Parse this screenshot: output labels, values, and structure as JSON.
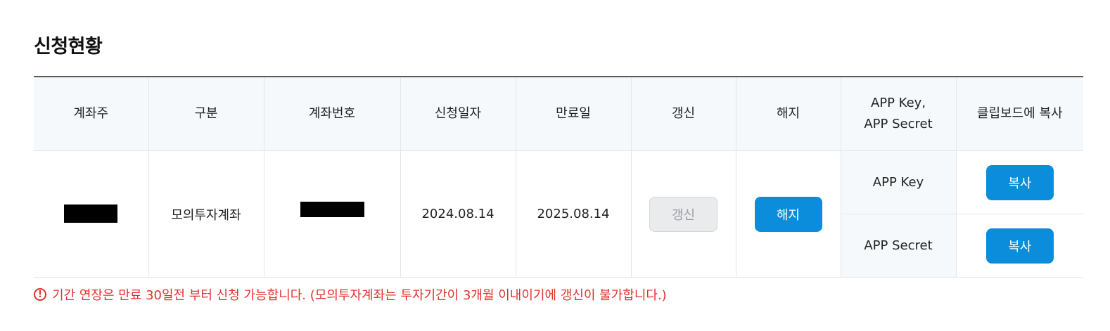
{
  "section": {
    "title": "신청현황"
  },
  "table": {
    "headers": {
      "holder": "계좌주",
      "type": "구분",
      "account_no": "계좌번호",
      "apply_date": "신청일자",
      "expiry_date": "만료일",
      "renew": "갱신",
      "cancel": "해지",
      "app_key_line1": "APP Key,",
      "app_key_line2": "APP Secret",
      "clipboard": "클립보드에 복사"
    },
    "row": {
      "type": "모의투자계좌",
      "apply_date": "2024.08.14",
      "expiry_date": "2025.08.14",
      "renew_label": "갱신",
      "cancel_label": "해지",
      "key_labels": [
        "APP Key",
        "APP Secret"
      ],
      "copy_labels": [
        "복사",
        "복사"
      ]
    }
  },
  "notice": {
    "icon": "alert-circle-icon",
    "text": "기간 연장은 만료 30일전 부터 신청 가능합니다. (모의투자계좌는 투자기간이 3개월 이내이기에 갱신이 불가합니다.)"
  },
  "colors": {
    "primary": "#0b8ddb",
    "notice": "#e0312a",
    "header_bg": "#f5f9fc"
  }
}
